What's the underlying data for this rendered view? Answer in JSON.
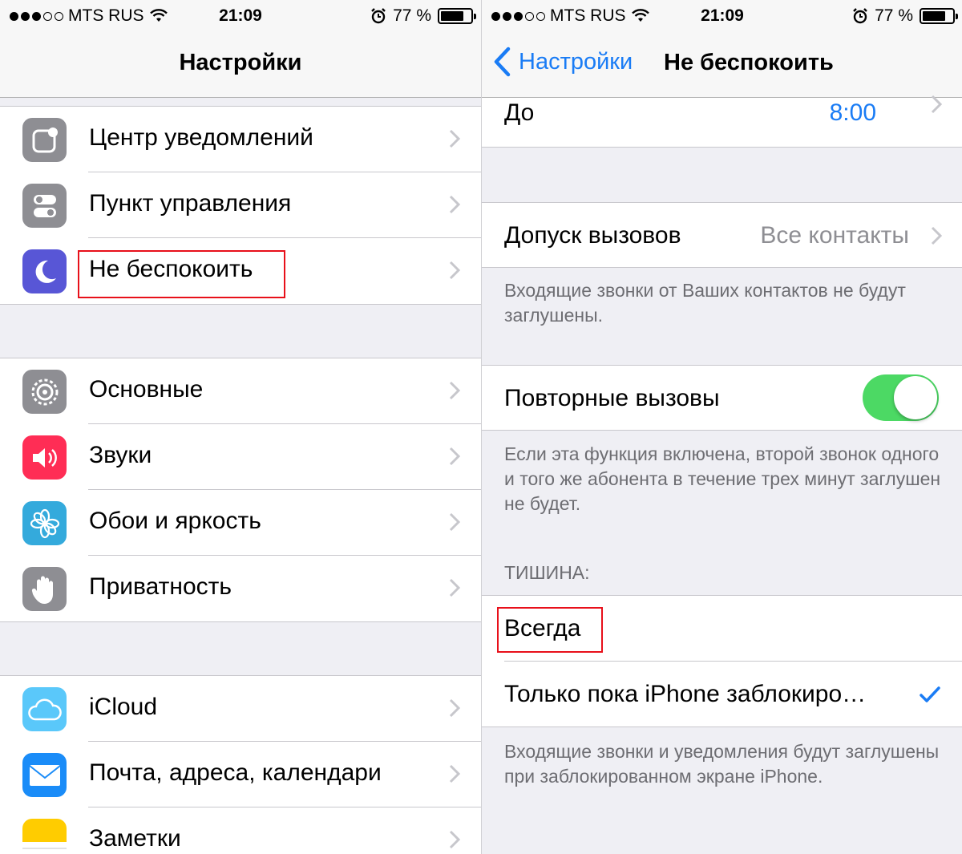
{
  "status_bar": {
    "carrier": "MTS RUS",
    "time": "21:09",
    "battery": "77 %",
    "battery_level": 0.77
  },
  "left_screen": {
    "title": "Настройки",
    "groups": [
      {
        "items": [
          {
            "label": "Центр уведомлений",
            "icon": "notification-center-icon",
            "color": "#8e8e93"
          },
          {
            "label": "Пункт управления",
            "icon": "control-center-icon",
            "color": "#8e8e93"
          },
          {
            "label": "Не беспокоить",
            "icon": "moon-icon",
            "color": "#5856d6",
            "highlighted": true
          }
        ]
      },
      {
        "items": [
          {
            "label": "Основные",
            "icon": "gear-icon",
            "color": "#8e8e93"
          },
          {
            "label": "Звуки",
            "icon": "speaker-icon",
            "color": "#ff2d55"
          },
          {
            "label": "Обои и яркость",
            "icon": "flower-icon",
            "color": "#34aadc"
          },
          {
            "label": "Приватность",
            "icon": "hand-icon",
            "color": "#8e8e93"
          }
        ]
      },
      {
        "items": [
          {
            "label": "iCloud",
            "icon": "cloud-icon",
            "color": "#5ac8fa"
          },
          {
            "label": "Почта, адреса, календари",
            "icon": "mail-icon",
            "color": "#1a8cf8"
          },
          {
            "label": "Заметки",
            "icon": "notes-icon",
            "color": "#ffcc00"
          }
        ]
      }
    ]
  },
  "right_screen": {
    "back_label": "Настройки",
    "title": "Не беспокоить",
    "until": {
      "label": "До",
      "value": "8:00"
    },
    "allow_calls": {
      "label": "Допуск вызовов",
      "value": "Все контакты"
    },
    "allow_calls_note": "Входящие звонки от Ваших контактов не будут заглушены.",
    "repeated_calls": {
      "label": "Повторные вызовы",
      "on": true
    },
    "repeated_calls_note": "Если эта функция включена, второй звонок одного и того же абонента в течение трех минут заглушен не будет.",
    "silence_header": "ТИШИНА:",
    "silence_options": [
      {
        "label": "Всегда",
        "checked": false,
        "highlighted": true
      },
      {
        "label": "Только пока iPhone заблокиро…",
        "checked": true
      }
    ],
    "silence_note": "Входящие звонки и уведомления будут заглушены при заблокированном экране iPhone."
  },
  "colors": {
    "accent": "#1a7cf5",
    "toggle_on": "#4cd964",
    "highlight": "#e8101a"
  }
}
